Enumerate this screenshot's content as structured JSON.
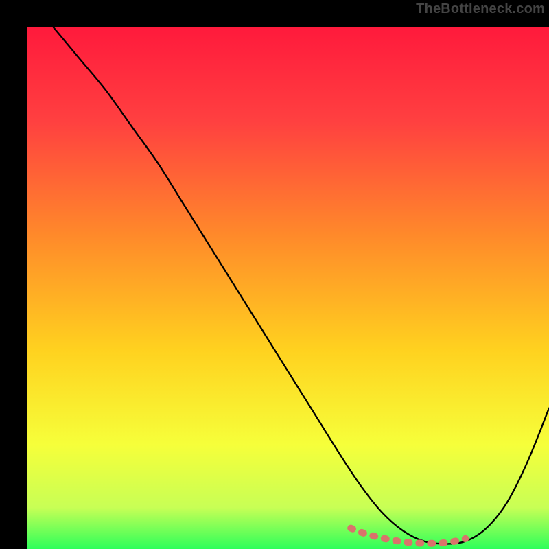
{
  "watermark": "TheBottleneck.com",
  "chart_data": {
    "type": "line",
    "title": "",
    "xlabel": "",
    "ylabel": "",
    "xlim": [
      0,
      100
    ],
    "ylim": [
      0,
      100
    ],
    "grid": false,
    "legend": false,
    "series": [
      {
        "name": "main-curve",
        "color": "#000000",
        "x": [
          5,
          10,
          15,
          20,
          25,
          30,
          35,
          40,
          45,
          50,
          55,
          60,
          64,
          68,
          72,
          76,
          80,
          84,
          88,
          92,
          96,
          100
        ],
        "y": [
          100,
          94,
          88,
          81,
          74,
          66,
          58,
          50,
          42,
          34,
          26,
          18,
          12,
          7,
          3.5,
          1.5,
          1,
          1.5,
          4,
          9,
          17,
          27
        ]
      },
      {
        "name": "highlight-band",
        "color": "#d9736b",
        "x": [
          62,
          64,
          66,
          68,
          70,
          72,
          74,
          76,
          78,
          80,
          82,
          84
        ],
        "y": [
          4.0,
          3.2,
          2.6,
          2.1,
          1.7,
          1.4,
          1.2,
          1.1,
          1.1,
          1.2,
          1.5,
          2.0
        ]
      }
    ],
    "background_gradient": {
      "type": "vertical",
      "stops": [
        {
          "offset": 0.0,
          "color": "#ff1a3c"
        },
        {
          "offset": 0.18,
          "color": "#ff4040"
        },
        {
          "offset": 0.4,
          "color": "#ff8a2a"
        },
        {
          "offset": 0.62,
          "color": "#ffd21f"
        },
        {
          "offset": 0.8,
          "color": "#f6ff3a"
        },
        {
          "offset": 0.92,
          "color": "#c8ff55"
        },
        {
          "offset": 1.0,
          "color": "#2dff5a"
        }
      ]
    }
  }
}
